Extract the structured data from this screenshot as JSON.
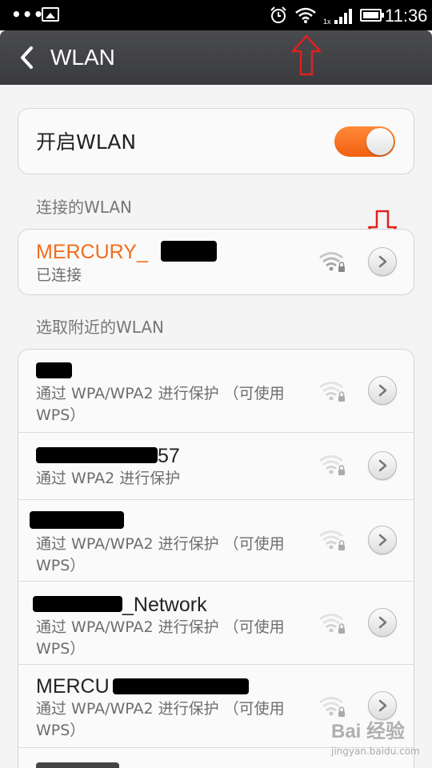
{
  "status_bar": {
    "dots": "•••",
    "time": "11:36",
    "icons": [
      "gallery-icon",
      "alarm-icon",
      "wifi-icon",
      "signal-icon",
      "battery-icon"
    ],
    "network_type": "1x"
  },
  "header": {
    "title": "WLAN"
  },
  "wlan_toggle": {
    "label": "开启WLAN",
    "enabled": true
  },
  "connected_section": {
    "label": "连接的WLAN",
    "network": {
      "name": "MERCURY_",
      "status": "已连接"
    }
  },
  "nearby_section": {
    "label": "选取附近的WLAN",
    "networks": [
      {
        "name": "",
        "security": "通过 WPA/WPA2 进行保护 （可使用 WPS）"
      },
      {
        "name": "57",
        "security": "通过 WPA2 进行保护"
      },
      {
        "name": "",
        "security": "通过 WPA/WPA2 进行保护 （可使用 WPS）"
      },
      {
        "name": "_Network",
        "security": "通过 WPA/WPA2 进行保护 （可使用 WPS）"
      },
      {
        "name": "MERCU",
        "security": "通过 WPA/WPA2 进行保护 （可使用 WPS）"
      }
    ]
  },
  "watermark": {
    "main": "Bai 经验",
    "sub": "jingyan.baidu.com"
  },
  "colors": {
    "accent": "#f26c1b",
    "annotation": "#e02020"
  }
}
